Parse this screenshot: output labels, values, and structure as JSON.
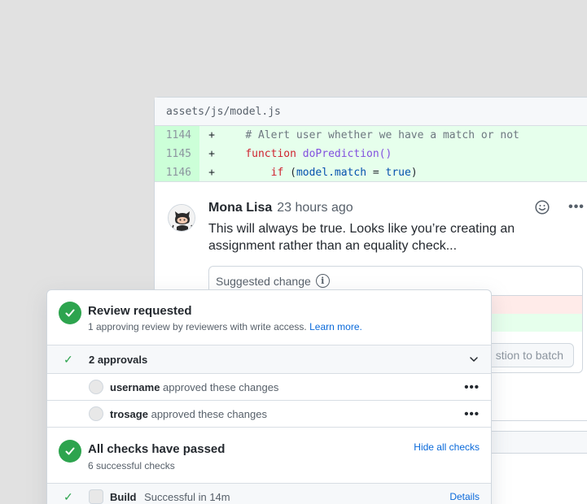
{
  "file": {
    "path": "assets/js/model.js"
  },
  "diff": {
    "lines": [
      {
        "num": "1144",
        "sign": "+"
      },
      {
        "num": "1145",
        "sign": "+"
      },
      {
        "num": "1146",
        "sign": "+"
      }
    ],
    "line1_comment": "# Alert user whether we have a match or not",
    "line2_kw": "function",
    "line2_fn": "doPrediction()",
    "line3_kw": "if",
    "line3_open": "(",
    "line3_var": "model.match",
    "line3_op": " = ",
    "line3_val": "true",
    "line3_close": ")"
  },
  "comment": {
    "author": "Mona Lisa",
    "time": "23 hours ago",
    "body": "This will always be true. Looks like you’re creating an assignment rather than an equality check...",
    "suggested_change_label": "Suggested change",
    "batch_button_label": "stion to batch",
    "more_label": "•••",
    "icons": {
      "reaction": "smiley-icon",
      "info": "info-icon"
    }
  },
  "merge_box": {
    "review": {
      "title": "Review requested",
      "subtitle": "1 approving review by reviewers with write access.",
      "learn_more": "Learn more.",
      "status_color": "#2da44e"
    },
    "approvals": {
      "label": "2 approvals",
      "tick": "✓",
      "reviewers": [
        {
          "name": "username",
          "action": "approved these changes",
          "more": "•••"
        },
        {
          "name": "trosage",
          "action": "approved these changes",
          "more": "•••"
        }
      ]
    },
    "checks": {
      "title": "All checks have passed",
      "subtitle": "6 successful checks",
      "hide_label": "Hide all checks",
      "items": [
        {
          "name": "Build",
          "status": "Successful in 14m",
          "details": "Details",
          "tick": "✓"
        }
      ]
    }
  }
}
